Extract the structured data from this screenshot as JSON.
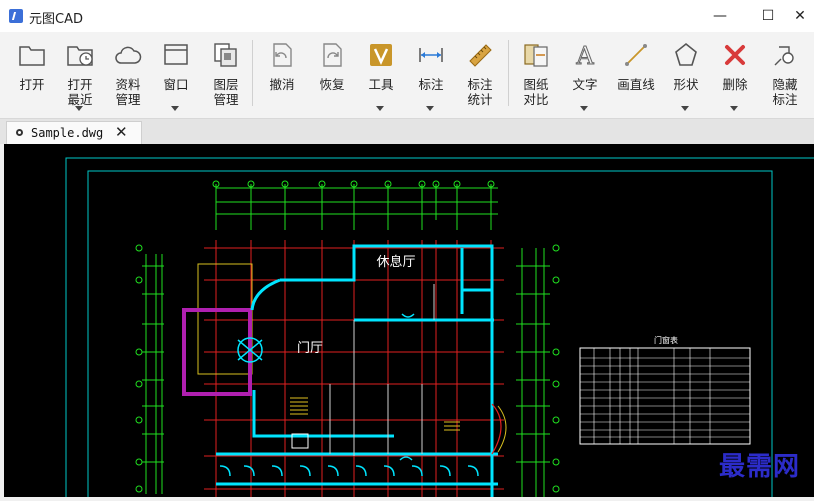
{
  "app": {
    "title": "元图CAD"
  },
  "window_controls": {
    "minimize": "—",
    "maximize": "☐",
    "close": "✕"
  },
  "toolbar": [
    {
      "id": "open",
      "label": "打开"
    },
    {
      "id": "open-recent",
      "label": "打开\n最近"
    },
    {
      "id": "resources",
      "label": "资料\n管理"
    },
    {
      "id": "window",
      "label": "窗口"
    },
    {
      "id": "layers",
      "label": "图层\n管理"
    },
    {
      "id": "undo",
      "label": "撤消"
    },
    {
      "id": "redo",
      "label": "恢复"
    },
    {
      "id": "tools",
      "label": "工具"
    },
    {
      "id": "dimension",
      "label": "标注"
    },
    {
      "id": "dimension-stats",
      "label": "标注\n统计"
    },
    {
      "id": "drawing-compare",
      "label": "图纸\n对比"
    },
    {
      "id": "text",
      "label": "文字"
    },
    {
      "id": "draw-line",
      "label": "画直线"
    },
    {
      "id": "shape",
      "label": "形状"
    },
    {
      "id": "delete",
      "label": "删除"
    },
    {
      "id": "hide-dimension",
      "label": "隐藏\n标注"
    }
  ],
  "document_tab": {
    "name": "Sample.dwg",
    "close": "✕"
  },
  "drawing": {
    "rooms": {
      "lounge": "休息厅",
      "lobby": "门厅"
    },
    "door_table": {
      "title": "门窗表"
    }
  },
  "watermark": "最需网",
  "colors": {
    "accent": "#3b6fd8",
    "cad_bg": "#000000",
    "grid": "#e02020",
    "frame": "#00d0d0",
    "axis": "#20e020",
    "wall": "#00e5ff"
  }
}
